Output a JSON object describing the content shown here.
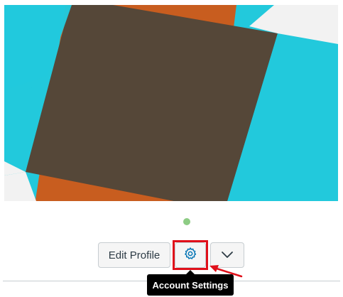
{
  "banner": {
    "colors": {
      "background": "#f2f2f2",
      "cyan": "#22c9dc",
      "orange": "#c85d1f",
      "square": "#554738"
    }
  },
  "status": {
    "color": "#8dcc84"
  },
  "actions": {
    "edit_profile_label": "Edit Profile",
    "settings_icon": "gear-icon",
    "more_icon": "chevron-down-icon"
  },
  "tooltip": {
    "text": "Account Settings"
  },
  "annotation": {
    "color": "#e0101a"
  }
}
